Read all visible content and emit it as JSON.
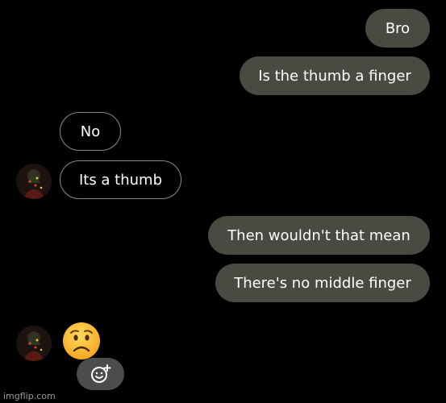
{
  "messages": [
    {
      "text": "Bro",
      "direction": "outgoing"
    },
    {
      "text": "Is the thumb a finger",
      "direction": "outgoing"
    },
    {
      "text": "No",
      "direction": "incoming"
    },
    {
      "text": "Its a thumb",
      "direction": "incoming"
    },
    {
      "text": "Then wouldn't that mean",
      "direction": "outgoing"
    },
    {
      "text": "There's no middle finger",
      "direction": "outgoing"
    },
    {
      "text": "",
      "direction": "incoming",
      "emoji": "worried-face-icon"
    }
  ],
  "react_button": {
    "icon": "add-reaction-icon"
  },
  "watermark": "imgflip.com",
  "colors": {
    "background": "#000000",
    "outgoing_bubble": "#4a4a42",
    "incoming_border": "#8a8a8a",
    "text": "#ffffff",
    "react_button": "#4c4c4c"
  }
}
